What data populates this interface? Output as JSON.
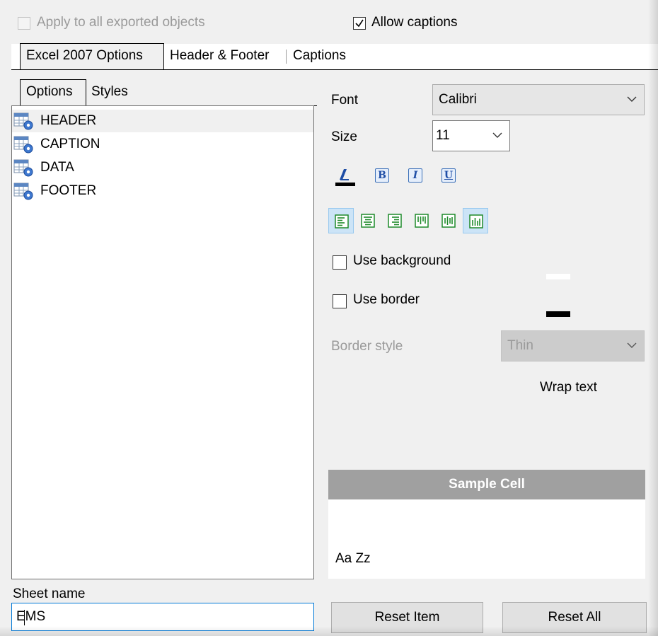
{
  "top": {
    "apply_all_label": "Apply to all exported objects",
    "apply_all_checked": false,
    "allow_captions_label": "Allow captions",
    "allow_captions_checked": true
  },
  "main_tabs": [
    {
      "label": "Excel 2007 Options",
      "active": true
    },
    {
      "label": "Header & Footer",
      "active": false
    },
    {
      "label": "Captions",
      "active": false
    }
  ],
  "sub_tabs": [
    {
      "label": "Options",
      "active": true
    },
    {
      "label": "Styles",
      "active": false
    }
  ],
  "style_items": [
    {
      "label": "HEADER",
      "selected": true
    },
    {
      "label": "CAPTION",
      "selected": false
    },
    {
      "label": "DATA",
      "selected": false
    },
    {
      "label": "FOOTER",
      "selected": false
    }
  ],
  "font": {
    "label": "Font",
    "value": "Calibri"
  },
  "size": {
    "label": "Size",
    "value": "11"
  },
  "format_buttons": [
    "B",
    "I",
    "U"
  ],
  "use_background": {
    "label": "Use background",
    "checked": false
  },
  "use_border": {
    "label": "Use border",
    "checked": false
  },
  "border_style": {
    "label": "Border style",
    "value": "Thin"
  },
  "wrap_text_label": "Wrap text",
  "sample": {
    "header": "Sample Cell",
    "text": "Aa Zz"
  },
  "sheet": {
    "label": "Sheet name",
    "value": "EMS"
  },
  "buttons": {
    "reset_item": "Reset Item",
    "reset_all": "Reset All"
  },
  "colors": {
    "accent": "#0078d7",
    "sample_header_bg": "#a0a0a0",
    "selection": "#cce4f7"
  }
}
